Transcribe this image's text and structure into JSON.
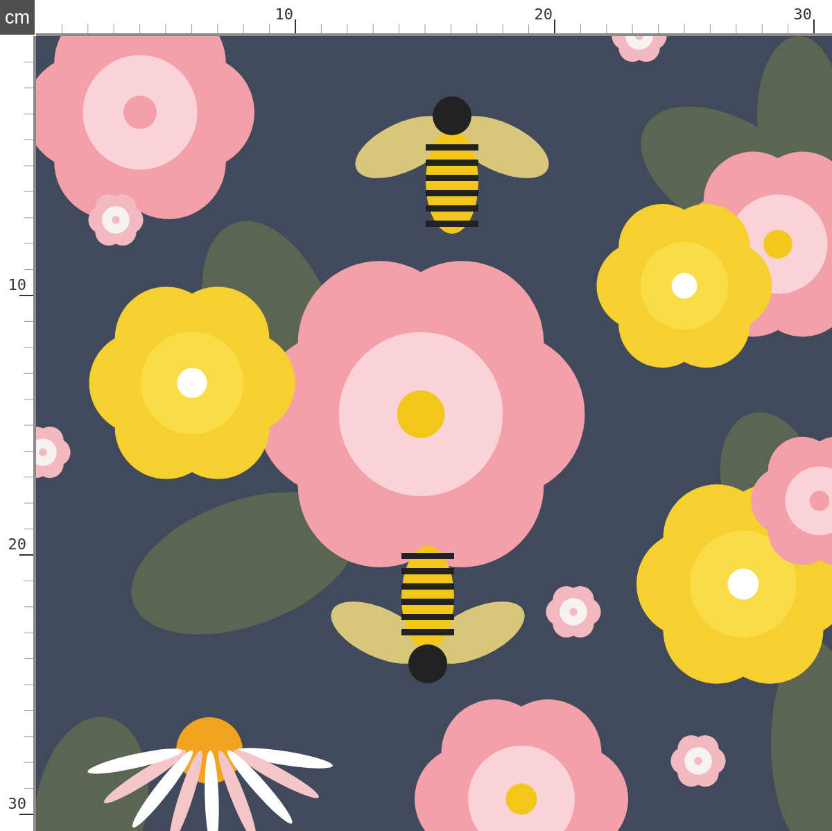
{
  "corner": {
    "unit": "cm"
  },
  "rulers": {
    "top": {
      "labels": [
        "10",
        "20",
        "30"
      ]
    },
    "left": {
      "labels": [
        "10",
        "20",
        "30"
      ]
    }
  }
}
